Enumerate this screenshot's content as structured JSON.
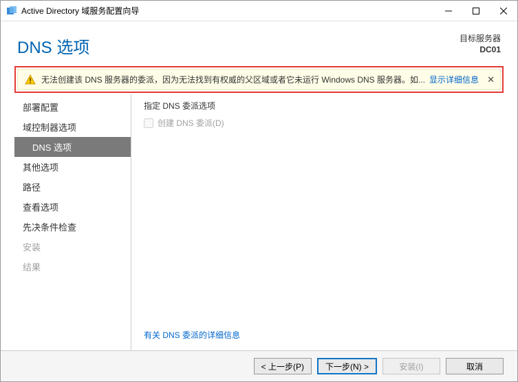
{
  "titlebar": {
    "title": "Active Directory 域服务配置向导"
  },
  "header": {
    "page_title": "DNS 选项",
    "target_label": "目标服务器",
    "target_name": "DC01"
  },
  "warning": {
    "text": "无法创建该 DNS 服务器的委派，因为无法找到有权威的父区域或者它未运行 Windows DNS 服务器。如...",
    "more_link": "显示详细信息"
  },
  "sidebar": {
    "items": [
      {
        "label": "部署配置",
        "class": "nav-item",
        "inter": "true"
      },
      {
        "label": "域控制器选项",
        "class": "nav-item",
        "inter": "true"
      },
      {
        "label": "DNS 选项",
        "class": "nav-item nav-sub active",
        "inter": "true"
      },
      {
        "label": "其他选项",
        "class": "nav-item",
        "inter": "true"
      },
      {
        "label": "路径",
        "class": "nav-item",
        "inter": "true"
      },
      {
        "label": "查看选项",
        "class": "nav-item",
        "inter": "true"
      },
      {
        "label": "先决条件检查",
        "class": "nav-item",
        "inter": "true"
      },
      {
        "label": "安装",
        "class": "nav-item disabled",
        "inter": "false"
      },
      {
        "label": "结果",
        "class": "nav-item disabled",
        "inter": "false"
      }
    ]
  },
  "content": {
    "section_label": "指定 DNS 委派选项",
    "checkbox_label": "创建 DNS 委派(D)",
    "more_info_link": "有关 DNS 委派的详细信息"
  },
  "footer": {
    "prev": "< 上一步(P)",
    "next": "下一步(N) >",
    "install": "安装(I)",
    "cancel": "取消"
  }
}
